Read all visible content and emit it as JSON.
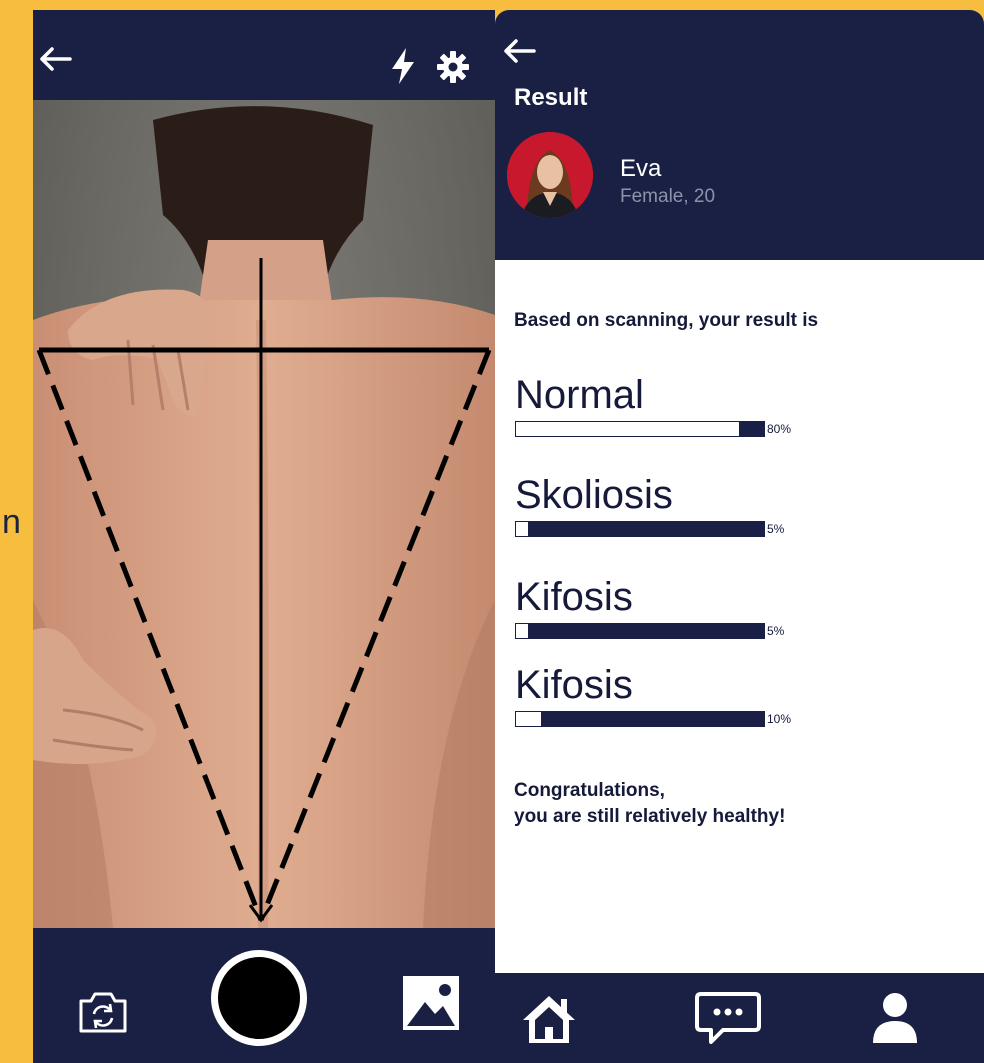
{
  "camera_screen": {
    "icons": {
      "back": "arrow-left-icon",
      "flash": "lightning-icon",
      "settings": "gear-icon",
      "flip_camera": "camera-flip-icon",
      "shutter": "shutter-circle",
      "gallery": "image-icon"
    },
    "colors": {
      "bar": "#192043",
      "guide_lines": "#000000"
    }
  },
  "result_screen": {
    "title": "Result",
    "user": {
      "name": "Eva",
      "meta": "Female, 20"
    },
    "intro": "Based on scanning, your result is",
    "metrics": [
      {
        "label": "Normal",
        "percent_text": "80%",
        "white_fraction": 0.9
      },
      {
        "label": "Skoliosis",
        "percent_text": "5%",
        "white_fraction": 0.05
      },
      {
        "label": "Kifosis",
        "percent_text": "5%",
        "white_fraction": 0.05
      },
      {
        "label": "Kifosis",
        "percent_text": "10%",
        "white_fraction": 0.1
      }
    ],
    "congrats_line1": "Congratulations,",
    "congrats_line2": "you are still relatively healthy!",
    "nav": {
      "home": "home-icon",
      "chat": "chat-bubble-icon",
      "profile": "user-icon"
    },
    "colors": {
      "navy": "#192043",
      "background": "#ffffff",
      "page": "#f6bd3f"
    }
  }
}
